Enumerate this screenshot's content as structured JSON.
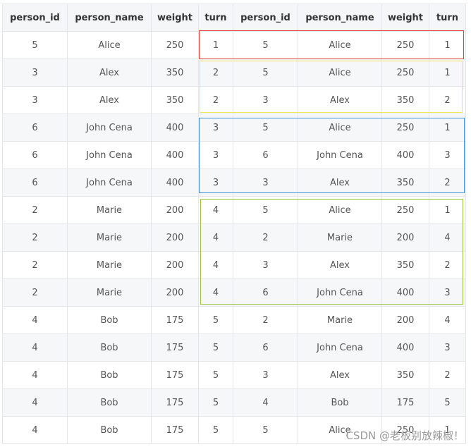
{
  "table": {
    "headers": [
      "person_id",
      "person_name",
      "weight",
      "turn",
      "person_id",
      "person_name",
      "weight",
      "turn"
    ],
    "rows": [
      [
        "5",
        "Alice",
        "250",
        "1",
        "5",
        "Alice",
        "250",
        "1"
      ],
      [
        "3",
        "Alex",
        "350",
        "2",
        "5",
        "Alice",
        "250",
        "1"
      ],
      [
        "3",
        "Alex",
        "350",
        "2",
        "3",
        "Alex",
        "350",
        "2"
      ],
      [
        "6",
        "John Cena",
        "400",
        "3",
        "5",
        "Alice",
        "250",
        "1"
      ],
      [
        "6",
        "John Cena",
        "400",
        "3",
        "6",
        "John Cena",
        "400",
        "3"
      ],
      [
        "6",
        "John Cena",
        "400",
        "3",
        "3",
        "Alex",
        "350",
        "2"
      ],
      [
        "2",
        "Marie",
        "200",
        "4",
        "5",
        "Alice",
        "250",
        "1"
      ],
      [
        "2",
        "Marie",
        "200",
        "4",
        "2",
        "Marie",
        "200",
        "4"
      ],
      [
        "2",
        "Marie",
        "200",
        "4",
        "3",
        "Alex",
        "350",
        "2"
      ],
      [
        "2",
        "Marie",
        "200",
        "4",
        "6",
        "John Cena",
        "400",
        "3"
      ],
      [
        "4",
        "Bob",
        "175",
        "5",
        "2",
        "Marie",
        "200",
        "4"
      ],
      [
        "4",
        "Bob",
        "175",
        "5",
        "6",
        "John Cena",
        "400",
        "3"
      ],
      [
        "4",
        "Bob",
        "175",
        "5",
        "3",
        "Alex",
        "350",
        "2"
      ],
      [
        "4",
        "Bob",
        "175",
        "5",
        "4",
        "Bob",
        "175",
        "5"
      ],
      [
        "4",
        "Bob",
        "175",
        "5",
        "5",
        "Alice",
        "250",
        "1"
      ]
    ]
  },
  "highlight_groups": [
    {
      "color": "#e0403b"
    },
    {
      "color": "#f2e45a"
    },
    {
      "color": "#3a8fd6"
    },
    {
      "color": "#9bc53d"
    }
  ],
  "watermark": "CSDN @老板别放辣椒！"
}
